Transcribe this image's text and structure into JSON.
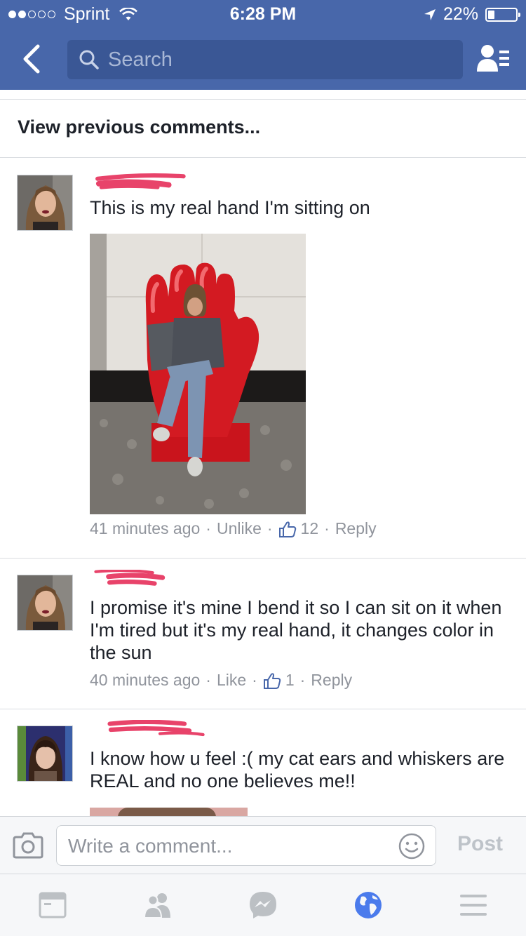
{
  "status_bar": {
    "carrier": "Sprint",
    "time": "6:28 PM",
    "battery": "22%",
    "signal_bars": 2,
    "signal_total": 5
  },
  "nav": {
    "search_placeholder": "Search",
    "icons": [
      "back-chevron-icon",
      "search-icon",
      "friend-requests-icon"
    ]
  },
  "comments_header": {
    "view_previous": "View previous comments..."
  },
  "comments": [
    {
      "text": "This is my real hand I'm sitting on",
      "time": "41 minutes ago",
      "action": "Unlike",
      "likes": "12",
      "reply": "Reply"
    },
    {
      "text": "I promise it's mine I bend it so I can sit on it when I'm tired but it's my real hand, it changes color in the sun",
      "time": "40 minutes ago",
      "action": "Like",
      "likes": "1",
      "reply": "Reply"
    },
    {
      "text": "I know how u feel :( my cat ears and whiskers are REAL and no one believes me!!"
    }
  ],
  "composer": {
    "placeholder": "Write a comment...",
    "post_label": "Post"
  },
  "colors": {
    "brand_blue": "#4867aa",
    "search_bg": "#3a5795",
    "meta_gray": "#90949c",
    "redaction_pink": "#e8436a"
  },
  "tab_bar": {
    "active": "notifications-globe",
    "tabs": [
      "news-feed-icon",
      "friends-icon",
      "messenger-icon",
      "globe-icon",
      "menu-icon"
    ]
  }
}
